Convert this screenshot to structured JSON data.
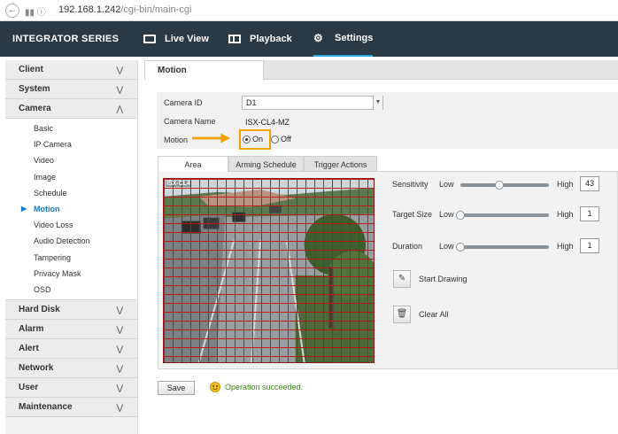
{
  "browser": {
    "url_host": "192.168.1.242",
    "url_path": "/cgi-bin/main-cgi"
  },
  "header": {
    "brand": "INTEGRATOR SERIES",
    "nav": [
      {
        "label": "Live View",
        "icon": "monitor-icon"
      },
      {
        "label": "Playback",
        "icon": "film-icon"
      },
      {
        "label": "Settings",
        "icon": "gear-icon",
        "active": true
      }
    ],
    "accent": "#28a9e0",
    "bg": "#2a3946"
  },
  "sidebar": {
    "groups": [
      {
        "label": "Client",
        "expanded": false
      },
      {
        "label": "System",
        "expanded": false
      },
      {
        "label": "Camera",
        "expanded": true,
        "items": [
          "Basic",
          "IP Camera",
          "Video",
          "Image",
          "Schedule",
          "Motion",
          "Video Loss",
          "Audio Detection",
          "Tampering",
          "Privacy Mask",
          "OSD"
        ],
        "active_item": "Motion"
      },
      {
        "label": "Hard Disk",
        "expanded": false
      },
      {
        "label": "Alarm",
        "expanded": false
      },
      {
        "label": "Alert",
        "expanded": false
      },
      {
        "label": "Network",
        "expanded": false
      },
      {
        "label": "User",
        "expanded": false
      },
      {
        "label": "Maintenance",
        "expanded": false
      }
    ]
  },
  "main": {
    "title": "Motion",
    "form": {
      "camera_id_label": "Camera ID",
      "camera_id_value": "D1",
      "camera_name_label": "Camera Name",
      "camera_name_value": "ISX-CL4-MZ",
      "motion_label": "Motion",
      "on_label": "On",
      "off_label": "Off",
      "motion_value": "On"
    },
    "tabs": [
      {
        "label": "Area",
        "active": true
      },
      {
        "label": "Arming Schedule"
      },
      {
        "label": "Trigger Actions"
      }
    ],
    "video_osd": "ISX-CL4",
    "sliders": [
      {
        "label": "Sensitivity",
        "low": "Low",
        "high": "High",
        "value": "43",
        "fraction": 0.43
      },
      {
        "label": "Target Size",
        "low": "Low",
        "high": "High",
        "value": "1",
        "fraction": 0.0
      },
      {
        "label": "Duration",
        "low": "Low",
        "high": "High",
        "value": "1",
        "fraction": 0.0
      }
    ],
    "tools": [
      {
        "label": "Start Drawing",
        "icon": "pencil-icon"
      },
      {
        "label": "Clear All",
        "icon": "trash-icon"
      }
    ],
    "save_label": "Save",
    "status_text": "Operation succeeded."
  }
}
